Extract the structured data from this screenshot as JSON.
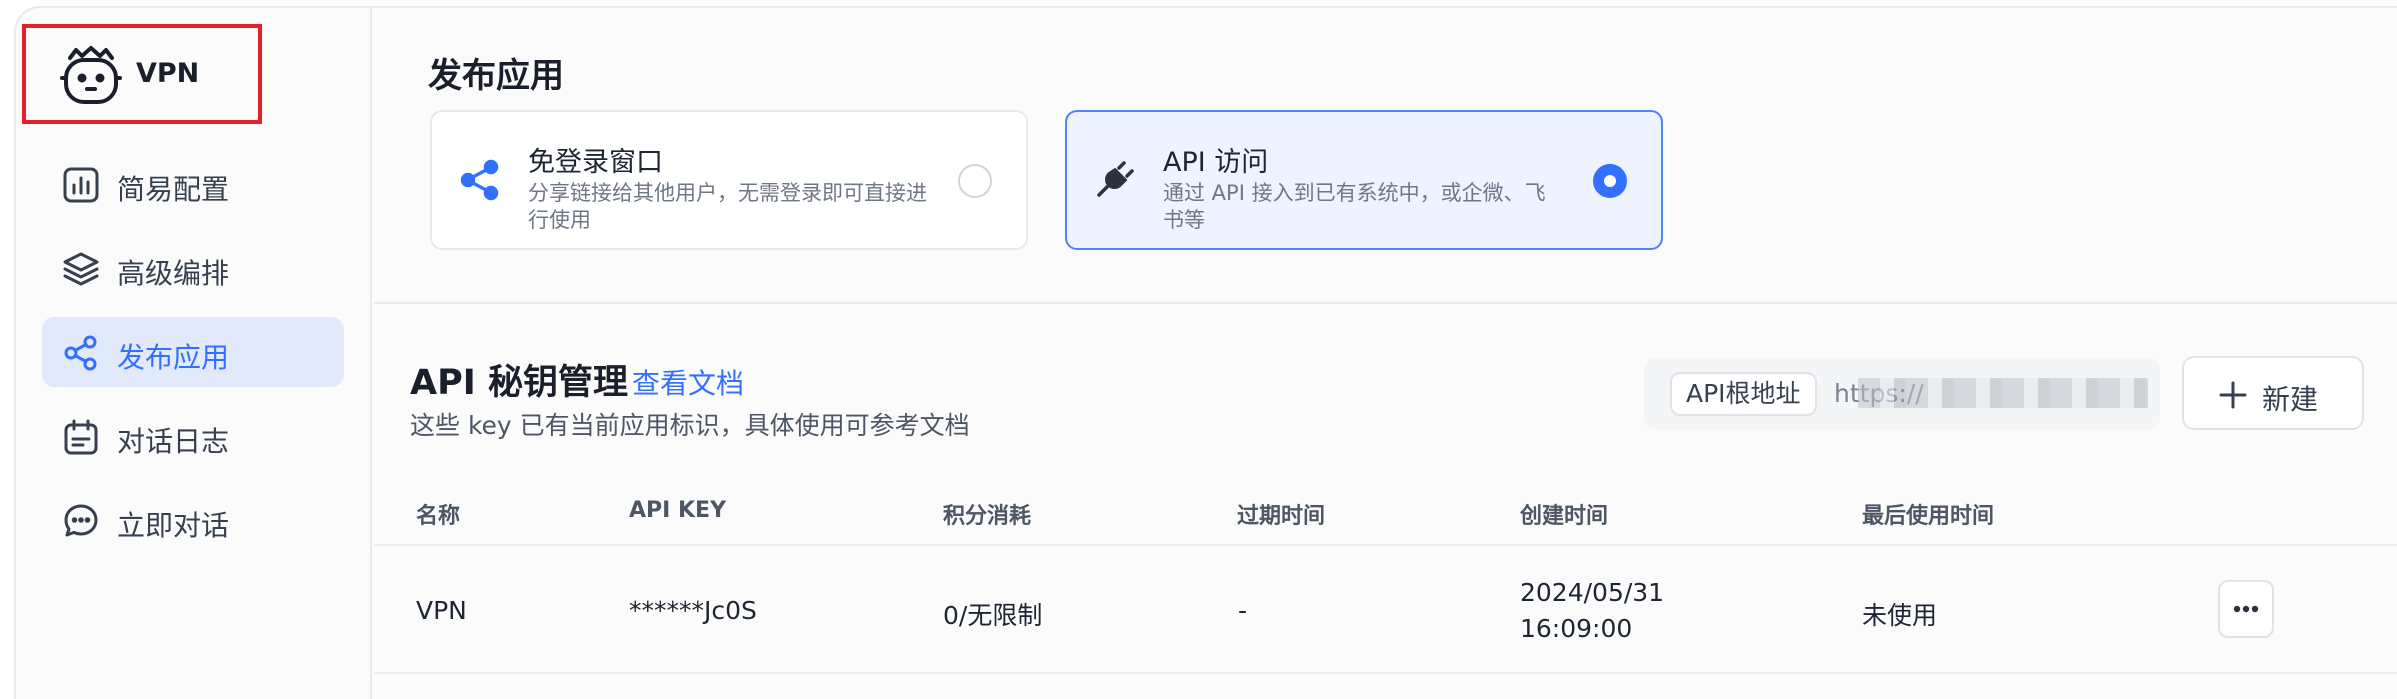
{
  "app": {
    "name": "VPN",
    "icon": "robot-icon"
  },
  "sidebar": {
    "items": [
      {
        "label": "简易配置",
        "icon": "bar-chart-icon",
        "active": false
      },
      {
        "label": "高级编排",
        "icon": "layers-icon",
        "active": false
      },
      {
        "label": "发布应用",
        "icon": "share-icon",
        "active": true
      },
      {
        "label": "对话日志",
        "icon": "calendar-icon",
        "active": false
      },
      {
        "label": "立即对话",
        "icon": "chat-bubble-icon",
        "active": false
      }
    ]
  },
  "publish": {
    "title": "发布应用",
    "options": [
      {
        "title": "免登录窗口",
        "desc": "分享链接给其他用户，无需登录即可直接进行使用",
        "icon": "share-nodes-icon",
        "selected": false
      },
      {
        "title": "API 访问",
        "desc": "通过 API 接入到已有系统中，或企微、飞书等",
        "icon": "plug-icon",
        "selected": true
      }
    ]
  },
  "api_keys": {
    "title": "API 秘钥管理",
    "doc_link": "查看文档",
    "subtitle": "这些 key 已有当前应用标识，具体使用可参考文档",
    "base_url_label": "API根地址",
    "base_url_value": "https://",
    "new_button": "新建",
    "columns": [
      "名称",
      "API KEY",
      "积分消耗",
      "过期时间",
      "创建时间",
      "最后使用时间"
    ],
    "rows": [
      {
        "name": "VPN",
        "key": "******Jc0S",
        "credits": "0/无限制",
        "expire": "-",
        "created_date": "2024/05/31",
        "created_time": "16:09:00",
        "last_used": "未使用"
      }
    ]
  },
  "colors": {
    "accent": "#3370ff",
    "highlight_border": "#e5202b"
  }
}
